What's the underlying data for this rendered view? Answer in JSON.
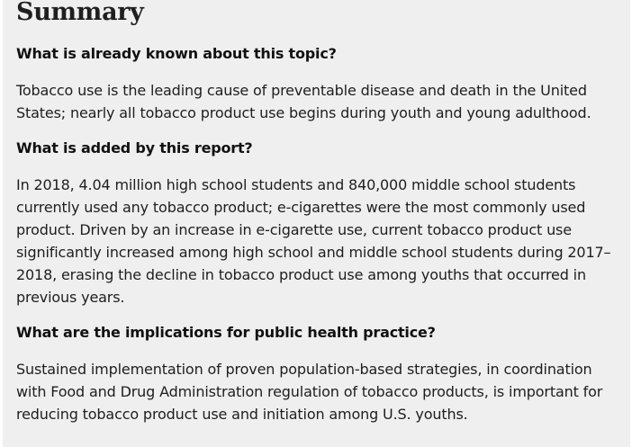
{
  "summary": {
    "title": "Summary",
    "sections": [
      {
        "question": "What is already known about this topic?",
        "answer": "Tobacco use is the leading cause of preventable disease and death in the United States; nearly all tobacco product use begins during youth and young adulthood."
      },
      {
        "question": "What is added by this report?",
        "answer": "In 2018, 4.04 million high school students and 840,000 middle school students currently used any tobacco product; e-cigarettes were the most commonly used product. Driven by an increase in e-cigarette use, current tobacco product use significantly increased among high school and middle school students during 2017–2018, erasing the decline in tobacco product use among youths that occurred in previous years."
      },
      {
        "question": "What are the implications for public health practice?",
        "answer": "Sustained implementation of proven population-based strategies, in coordination with Food and Drug Administration regulation of tobacco products, is important for reducing tobacco product use and initiation among U.S. youths."
      }
    ]
  }
}
